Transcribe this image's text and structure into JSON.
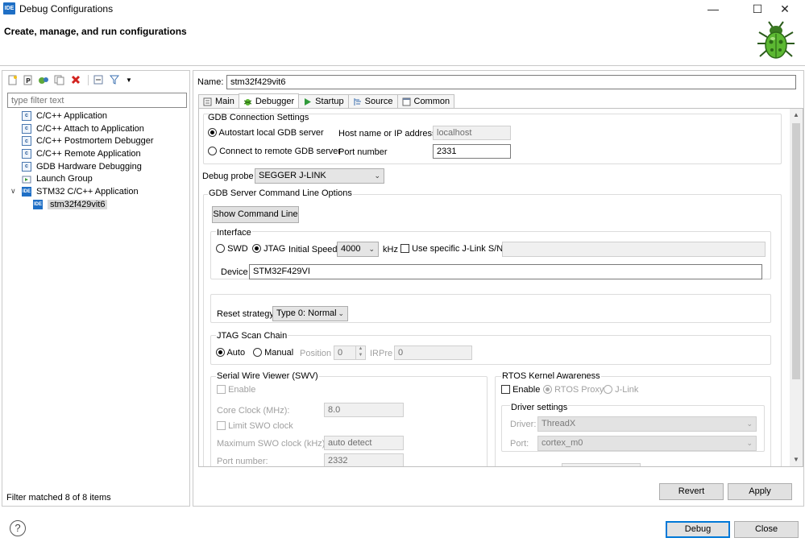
{
  "window": {
    "title": "Debug Configurations",
    "app_icon": "IDE",
    "header_description": "Create, manage, and run configurations"
  },
  "left_pane": {
    "filter_placeholder": "type filter text",
    "tree": [
      {
        "label": "C/C++ Application",
        "icon": "c-icon",
        "glyph": "c"
      },
      {
        "label": "C/C++ Attach to Application",
        "icon": "c-icon",
        "glyph": "c"
      },
      {
        "label": "C/C++ Postmortem Debugger",
        "icon": "c-icon",
        "glyph": "c"
      },
      {
        "label": "C/C++ Remote Application",
        "icon": "c-icon",
        "glyph": "c"
      },
      {
        "label": "GDB Hardware Debugging",
        "icon": "c-icon",
        "glyph": "c"
      },
      {
        "label": "Launch Group",
        "icon": "launch-group-icon",
        "glyph": ""
      },
      {
        "label": "STM32 C/C++ Application",
        "icon": "ide-icon",
        "glyph": "IDE",
        "expanded": true
      },
      {
        "label": "stm32f429vit6",
        "icon": "ide-icon",
        "glyph": "IDE",
        "selected": true
      }
    ],
    "status": "Filter matched 8 of 8 items"
  },
  "config": {
    "name_label": "Name:",
    "name_value": "stm32f429vit6",
    "tabs": [
      {
        "label": "Main",
        "icon": "main-icon"
      },
      {
        "label": "Debugger",
        "icon": "debugger-bug-icon",
        "active": true
      },
      {
        "label": "Startup",
        "icon": "startup-play-icon"
      },
      {
        "label": "Source",
        "icon": "source-icon"
      },
      {
        "label": "Common",
        "icon": "common-icon"
      }
    ]
  },
  "debugger": {
    "gdb_connection": {
      "title": "GDB Connection Settings",
      "autostart_label": "Autostart local GDB server",
      "remote_label": "Connect to remote GDB server",
      "selected": "autostart",
      "host_label": "Host name or IP address",
      "host_value": "localhost",
      "port_label": "Port number",
      "port_value": "2331"
    },
    "probe_label": "Debug probe",
    "probe_value": "SEGGER J-LINK",
    "gdb_server_options_title": "GDB Server Command Line Options",
    "show_command_line_label": "Show Command Line",
    "interface": {
      "title": "Interface",
      "swd_label": "SWD",
      "jtag_label": "JTAG",
      "selected": "jtag",
      "speed_label": "Initial Speed",
      "speed_value": "4000",
      "speed_unit": "kHz",
      "specific_sn_label": "Use specific J-Link S/N",
      "sn_value": "",
      "device_label": "Device",
      "device_value": "STM32F429VI"
    },
    "reset_label": "Reset strategy",
    "reset_value": "Type 0: Normal",
    "jtag_scan": {
      "title": "JTAG Scan Chain",
      "auto_label": "Auto",
      "manual_label": "Manual",
      "selected": "auto",
      "position_label": "Position",
      "position_value": "0",
      "irpre_label": "IRPre",
      "irpre_value": "0"
    },
    "swv": {
      "title": "Serial Wire Viewer (SWV)",
      "enable_label": "Enable",
      "core_clock_label": "Core Clock (MHz):",
      "core_clock_value": "8.0",
      "limit_swo_label": "Limit SWO clock",
      "max_swo_label": "Maximum SWO clock (kHz):",
      "max_swo_value": "auto detect",
      "port_label": "Port number:",
      "port_value": "2332"
    },
    "rtos": {
      "title": "RTOS Kernel Awareness",
      "enable_label": "Enable",
      "rtos_proxy_label": "RTOS Proxy",
      "jlink_label": "J-Link",
      "driver_settings_title": "Driver settings",
      "driver_label": "Driver:",
      "driver_value": "ThreadX",
      "port_label": "Port:",
      "port_value": "cortex_m0"
    }
  },
  "buttons": {
    "revert": "Revert",
    "apply": "Apply",
    "debug": "Debug",
    "close": "Close"
  }
}
